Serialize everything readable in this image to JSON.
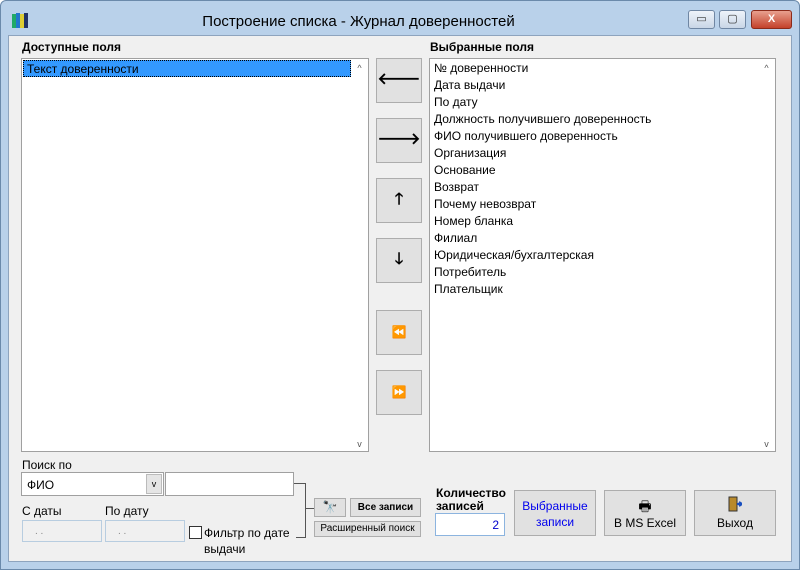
{
  "window": {
    "title": "Построение списка - Журнал доверенностей",
    "minimize": "▭",
    "maximize": "▢",
    "close": "X"
  },
  "available": {
    "label": "Доступные поля",
    "items": [
      "Текст доверенности"
    ]
  },
  "selected": {
    "label": "Выбранные поля",
    "items": [
      "№ доверенности",
      "Дата выдачи",
      "По дату",
      "Должность получившего доверенность",
      "ФИО получившего доверенность",
      "Организация",
      "Основание",
      "Возврат",
      "Почему невозврат",
      "Номер бланка",
      "Филиал",
      "Юридическая/бухгалтерская",
      "Потребитель",
      "Плательщик"
    ]
  },
  "move_buttons": {
    "left": "🡐",
    "right": "🡒",
    "up": "🡑",
    "down": "🡓",
    "all_left": "⏪",
    "all_right": "⏩"
  },
  "search": {
    "label": "Поиск по",
    "field": "ФИО",
    "value": "",
    "from_label": "С даты",
    "from_value": ". .",
    "to_label": "По дату",
    "to_value": ". .",
    "filter_label1": "Фильтр по дате",
    "filter_label2": "выдачи",
    "filter_checked": false,
    "all_records": "Все записи",
    "advanced": "Расширенный поиск"
  },
  "count": {
    "label1": "Количество",
    "label2": "записей",
    "value": "2"
  },
  "buttons": {
    "selected1": "Выбранные",
    "selected2": "записи",
    "excel": "В MS Excel",
    "exit": "Выход"
  }
}
